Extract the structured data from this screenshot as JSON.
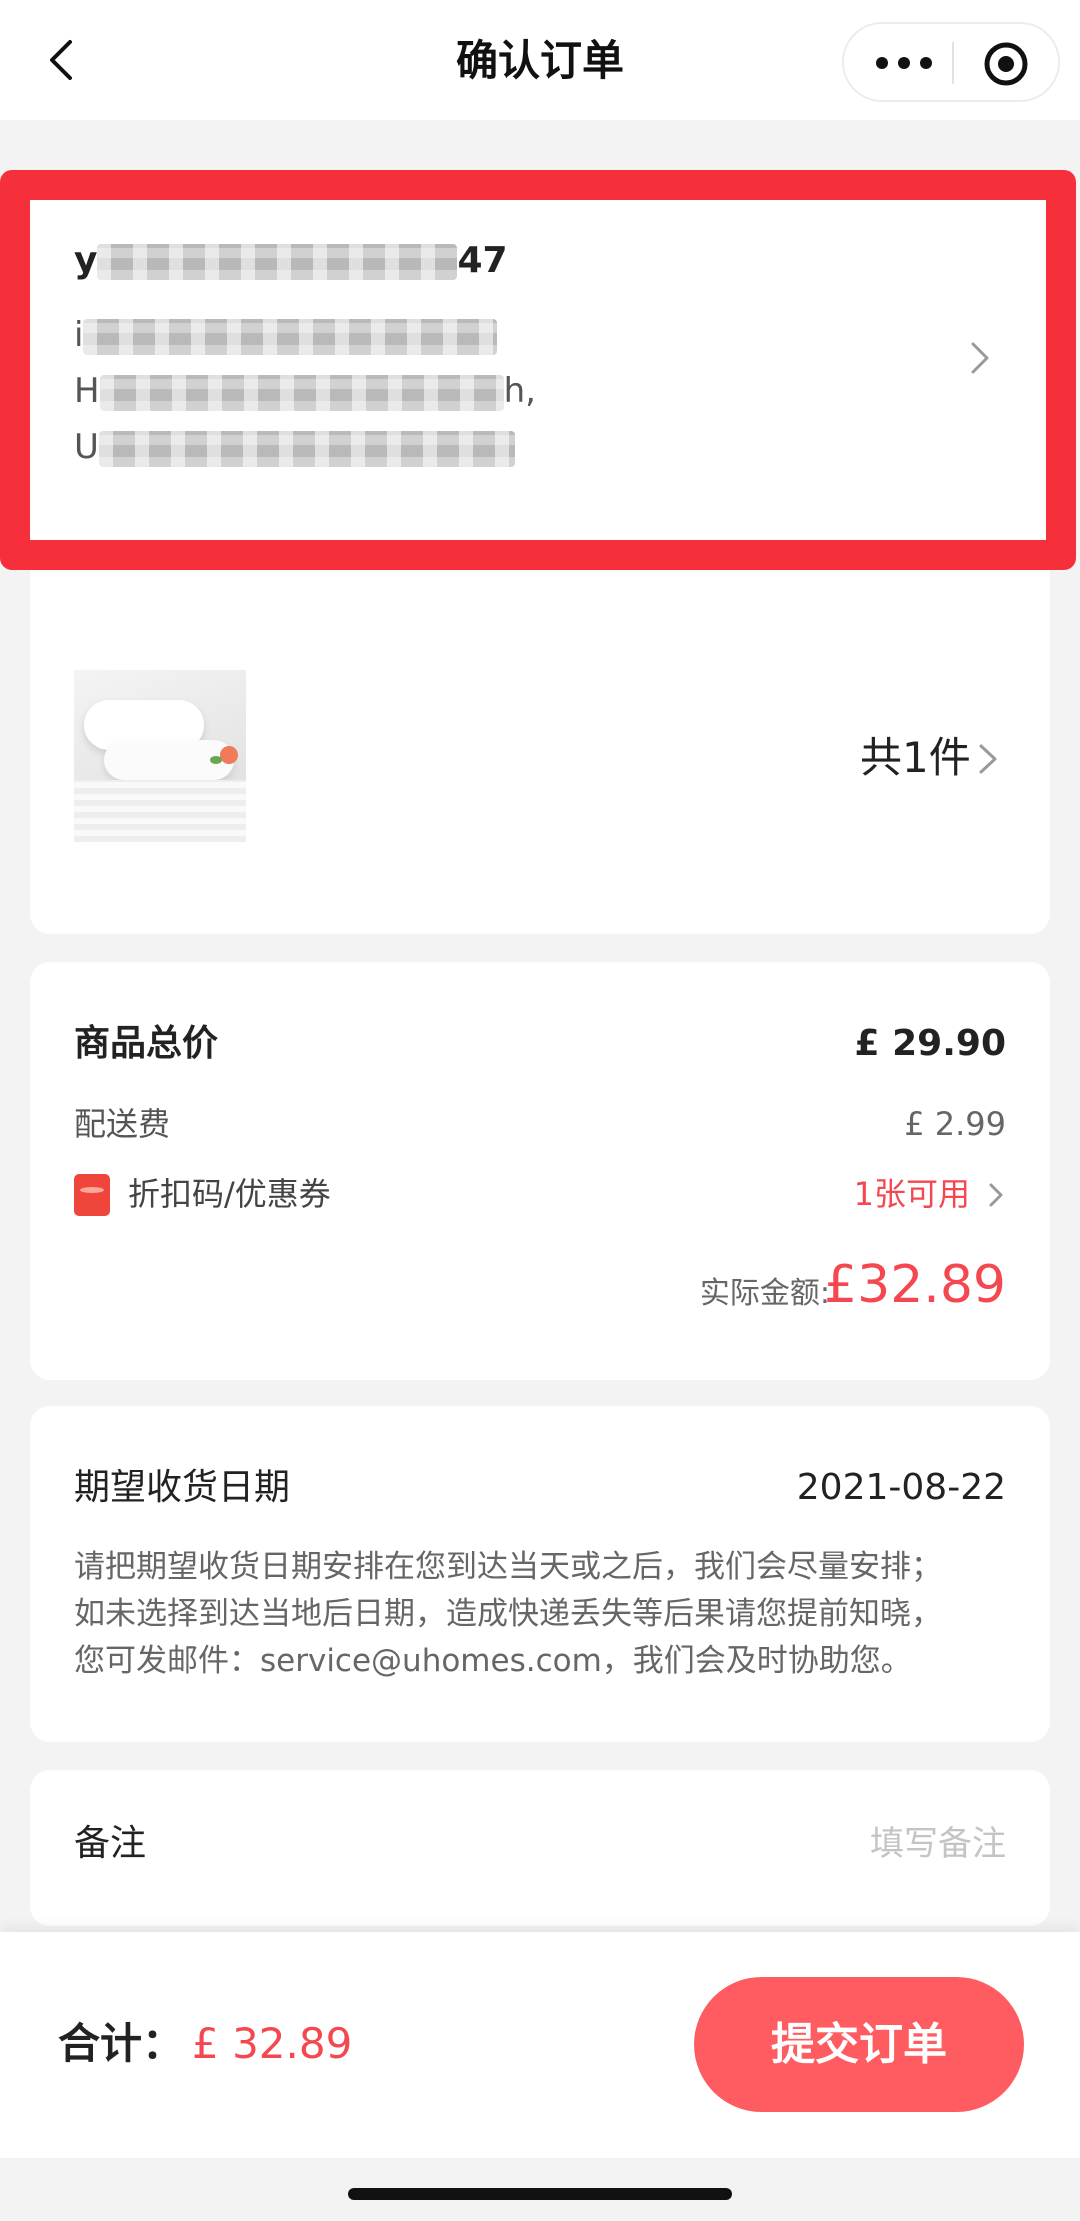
{
  "nav": {
    "title": "确认订单"
  },
  "address": {
    "name_prefix": "y",
    "name_suffix": "47",
    "line1_start": "i",
    "line1_end": "",
    "line2_start": "H",
    "line2_end": "h,",
    "line3_start": "U"
  },
  "product": {
    "count_label": "共1件"
  },
  "price": {
    "goods_label": "商品总价",
    "goods_value": "£ 29.90",
    "shipping_label": "配送费",
    "shipping_value": "£ 2.99",
    "coupon_label": "折扣码/优惠券",
    "coupon_value": "1张可用",
    "actual_label": "实际金额:",
    "actual_value": "£32.89"
  },
  "delivery": {
    "title": "期望收货日期",
    "date": "2021-08-22",
    "note_lines": [
      "请把期望收货日期安排在您到达当天或之后，我们会尽量安排；",
      "如未选择到达当地后日期，造成快递丢失等后果请您提前知晓，",
      "您可发邮件：service@uhomes.com，我们会及时协助您。"
    ]
  },
  "remark": {
    "label": "备注",
    "placeholder": "填写备注",
    "value": ""
  },
  "bottom": {
    "total_label": "合计：",
    "total_value": "£ 32.89",
    "submit_label": "提交订单"
  },
  "colors": {
    "accent": "#f5474f",
    "button": "#fe5c61",
    "highlight_frame": "#f5303a"
  }
}
